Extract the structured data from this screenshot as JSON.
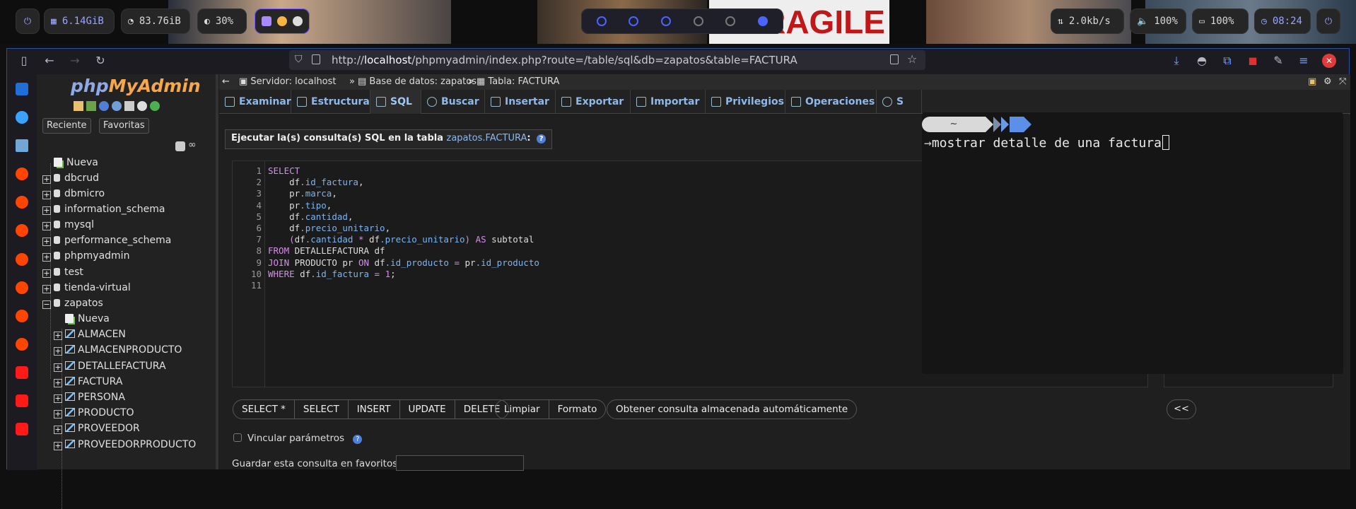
{
  "system_bar": {
    "memory": "6.14GiB",
    "disk": "83.76iB",
    "cpu": "30%",
    "network": "2.0kb/s",
    "volume": "100%",
    "battery": "100%",
    "clock": "08:24",
    "wallpaper_text": "FRAGILE"
  },
  "browser": {
    "url_prefix": "http://",
    "url_host": "localhost",
    "url_path": "/phpmyadmin/index.php?route=/table/sql&db=zapatos&table=FACTURA"
  },
  "pma_nav": {
    "logo_php": "php",
    "logo_my": "MyAdmin",
    "recent_label": "Reciente",
    "favorites_label": "Favoritas",
    "new_label": "Nueva",
    "databases": [
      "dbcrud",
      "dbmicro",
      "information_schema",
      "mysql",
      "performance_schema",
      "phpmyadmin",
      "test",
      "tienda-virtual",
      "zapatos"
    ],
    "zapatos_new": "Nueva",
    "tables": [
      "ALMACEN",
      "ALMACENPRODUCTO",
      "DETALLEFACTURA",
      "FACTURA",
      "PERSONA",
      "PRODUCTO",
      "PROVEEDOR",
      "PROVEEDORPRODUCTO"
    ]
  },
  "breadcrumb": {
    "server": "Servidor: localhost",
    "database": "Base de datos: zapatos",
    "table": "Tabla: FACTURA",
    "separator": "»"
  },
  "tabs": [
    "Examinar",
    "Estructura",
    "SQL",
    "Buscar",
    "Insertar",
    "Exportar",
    "Importar",
    "Privilegios",
    "Operaciones",
    "S"
  ],
  "sql_panel": {
    "legend_prefix": "Ejecutar la(s) consulta(s) SQL en la tabla",
    "legend_table": "zapatos.FACTURA",
    "legend_suffix": ":",
    "code_lines": [
      "SELECT",
      "    df.id_factura,",
      "    pr.marca,",
      "    pr.tipo,",
      "    df.cantidad,",
      "    df.precio_unitario,",
      "    (df.cantidad * df.precio_unitario) AS subtotal",
      "FROM DETALLEFACTURA df",
      "JOIN PRODUCTO pr ON df.id_producto = pr.id_producto",
      "WHERE df.id_factura = 1;",
      ""
    ],
    "buttons_group1": [
      "SELECT *",
      "SELECT",
      "INSERT",
      "UPDATE",
      "DELETE"
    ],
    "buttons_group2": [
      "Limpiar",
      "Formato"
    ],
    "stored_query_button": "Obtener consulta almacenada automáticamente",
    "collapse_button": "<<",
    "bind_params_label": "Vincular parámetros",
    "favorite_label": "Guardar esta consulta en favoritos:"
  },
  "terminal": {
    "prompt_dir": "~",
    "command": "mostrar detalle de una factura"
  }
}
